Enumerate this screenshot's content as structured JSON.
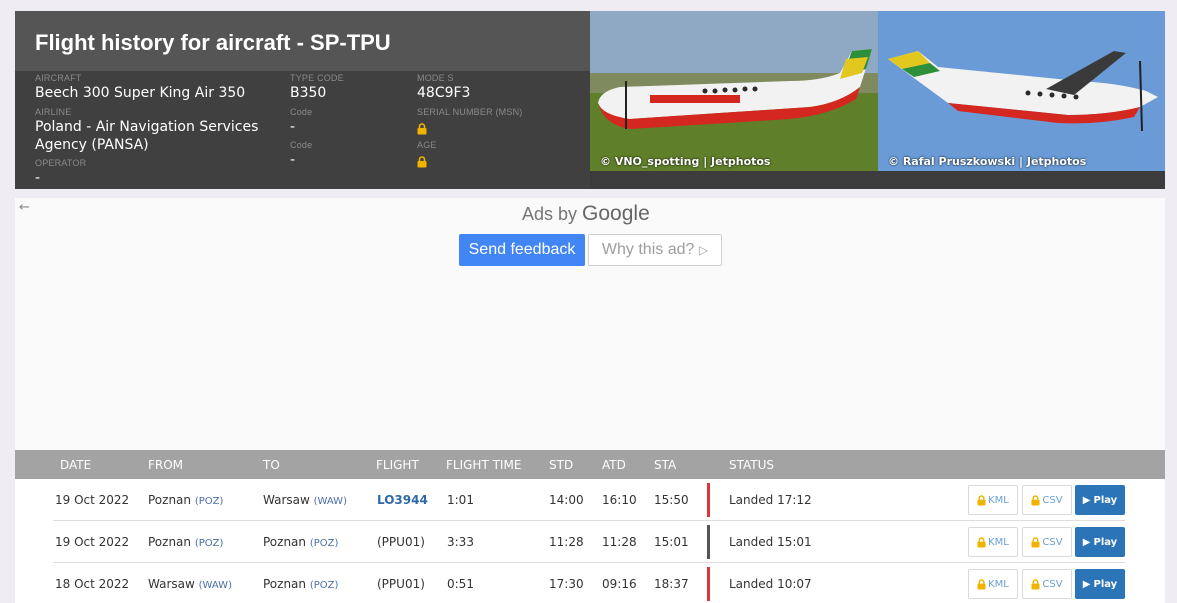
{
  "header": {
    "title": "Flight history for aircraft - SP-TPU",
    "aircraft_label": "AIRCRAFT",
    "aircraft_value": "Beech 300 Super King Air 350",
    "airline_label": "AIRLINE",
    "airline_value": "Poland - Air Navigation Services Agency (PANSA)",
    "operator_label": "OPERATOR",
    "operator_value": "-",
    "type_code_label": "TYPE CODE",
    "type_code_value": "B350",
    "code_label_1": "Code",
    "code_value_1": "-",
    "code_label_2": "Code",
    "code_value_2": "-",
    "mode_s_label": "MODE S",
    "mode_s_value": "48C9F3",
    "serial_label": "SERIAL NUMBER (MSN)",
    "age_label": "AGE",
    "lock_color": "#f0b400",
    "photos": [
      {
        "credit": "© VNO_spotting | Jetphotos"
      },
      {
        "credit": "© Rafal Pruszkowski | Jetphotos"
      }
    ]
  },
  "ad": {
    "back_icon": "arrow-left-icon",
    "ads_by": "Ads by",
    "google": "Google",
    "send_feedback": "Send feedback",
    "why_this_ad": "Why this ad?",
    "feedback_color": "#4285f4"
  },
  "table": {
    "columns": [
      "DATE",
      "FROM",
      "TO",
      "FLIGHT",
      "FLIGHT TIME",
      "STD",
      "ATD",
      "STA",
      "STATUS"
    ],
    "kml_label": "KML",
    "csv_label": "CSV",
    "play_label": "Play",
    "rows": [
      {
        "date": "19 Oct 2022",
        "from": "Poznan",
        "from_code": "(POZ)",
        "to": "Warsaw",
        "to_code": "(WAW)",
        "flight": "LO3944",
        "flight_time": "1:01",
        "std": "14:00",
        "atd": "16:10",
        "sta": "15:50",
        "status": "Landed 17:12",
        "status_color": "#d9353b"
      },
      {
        "date": "19 Oct 2022",
        "from": "Poznan",
        "from_code": "(POZ)",
        "to": "Poznan",
        "to_code": "(POZ)",
        "flight": "(PPU01)",
        "flight_time": "3:33",
        "std": "11:28",
        "atd": "11:28",
        "sta": "15:01",
        "status": "Landed 15:01",
        "status_color": "#555555"
      },
      {
        "date": "18 Oct 2022",
        "from": "Warsaw",
        "from_code": "(WAW)",
        "to": "Poznan",
        "to_code": "(POZ)",
        "flight": "(PPU01)",
        "flight_time": "0:51",
        "std": "17:30",
        "atd": "09:16",
        "sta": "18:37",
        "status": "Landed 10:07",
        "status_color": "#d9353b"
      }
    ]
  }
}
